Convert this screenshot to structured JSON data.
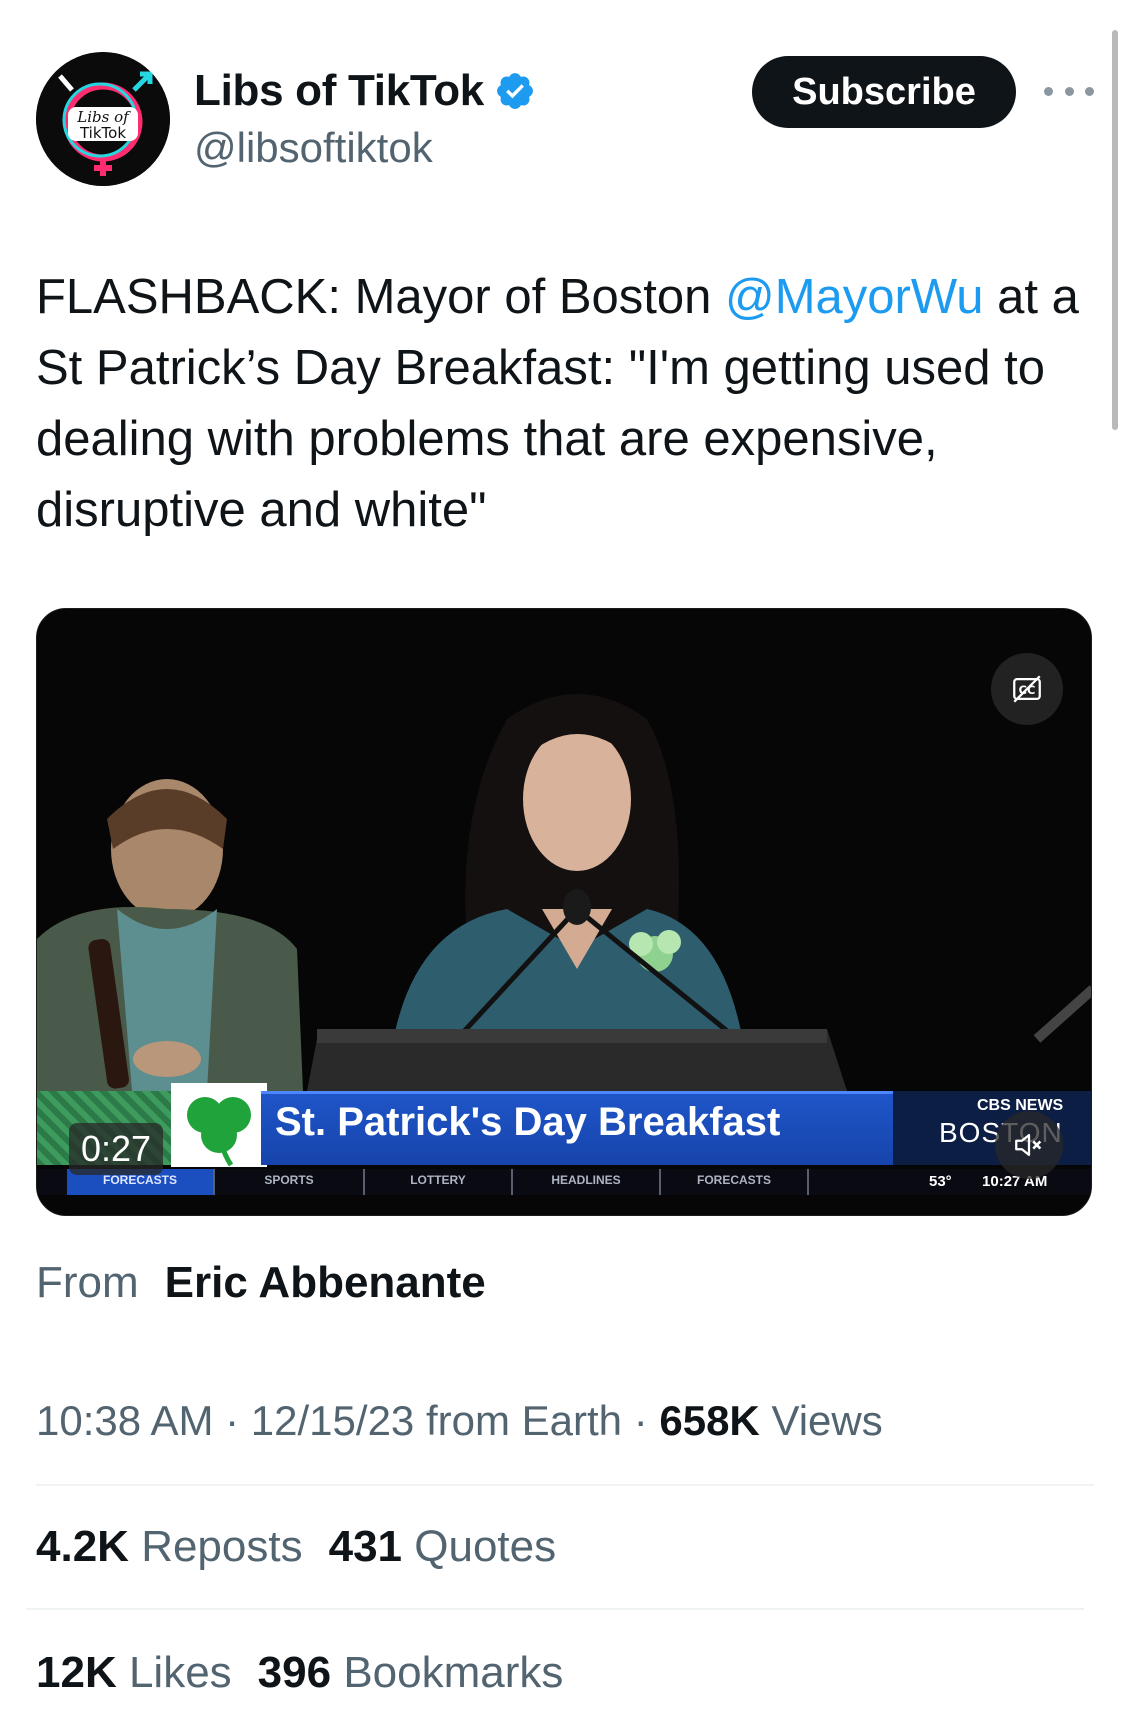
{
  "account": {
    "display_name": "Libs of TikTok",
    "handle": "@libsoftiktok",
    "avatar_text_line1": "Libs of",
    "avatar_text_line2": "TikTok",
    "verified_badge": "verified-badge-icon"
  },
  "actions": {
    "subscribe_label": "Subscribe",
    "more_icon": "more-options-icon"
  },
  "tweet": {
    "text_before_mention": "FLASHBACK: Mayor of Boston ",
    "mention": "@MayorWu",
    "text_after_mention": " at a St Patrick’s Day Breakfast: \"I'm getting used to dealing with problems that are expensive, disruptive and white\""
  },
  "video": {
    "duration": "0:27",
    "cc_icon": "closed-captions-icon",
    "mute_icon": "muted-speaker-icon",
    "banner_title": "St. Patrick's Day Breakfast",
    "network_name": "CBS NEWS",
    "network_city": "BOSTON",
    "ticker": [
      "FORECASTS",
      "SPORTS",
      "LOTTERY",
      "HEADLINES",
      "FORECASTS"
    ],
    "temperature": "53°",
    "clock": "10:27 AM"
  },
  "from": {
    "label": "From",
    "name": "Eric Abbenante"
  },
  "meta": {
    "time": "10:38 AM",
    "date": "12/15/23",
    "source": "from Earth",
    "views_count": "658K",
    "views_label": "Views"
  },
  "stats": {
    "reposts_count": "4.2K",
    "reposts_label": "Reposts",
    "quotes_count": "431",
    "quotes_label": "Quotes",
    "likes_count": "12K",
    "likes_label": "Likes",
    "bookmarks_count": "396",
    "bookmarks_label": "Bookmarks"
  },
  "colors": {
    "link": "#1d9bf0",
    "primary_text": "#0f1419",
    "secondary_text": "#536471",
    "subscribe_bg": "#0f1419",
    "verified": "#1d9bf0",
    "banner_blue": "#1f55c8"
  }
}
